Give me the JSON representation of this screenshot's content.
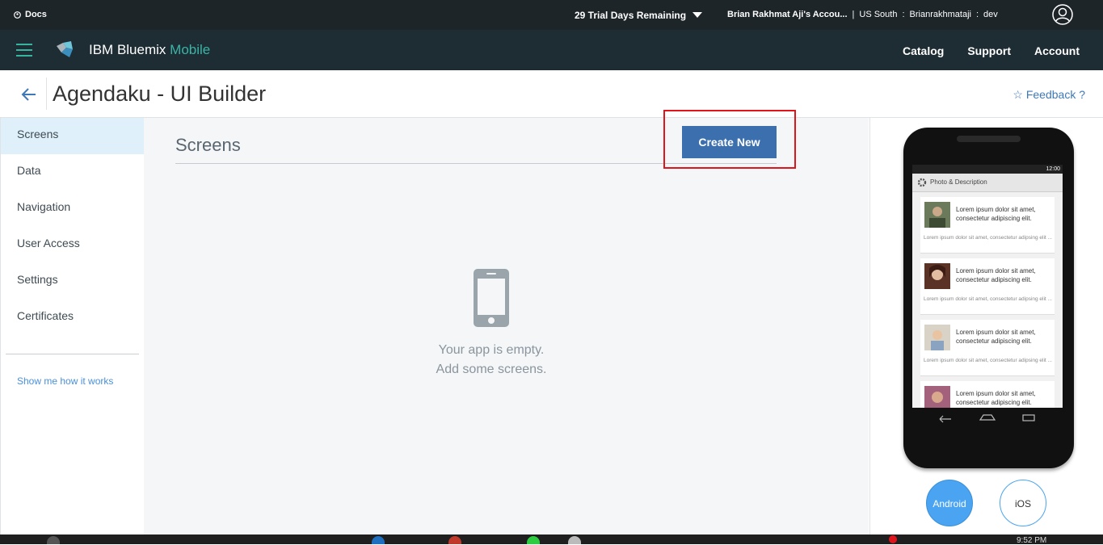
{
  "topbar": {
    "docs": "Docs",
    "trial": "29 Trial Days Remaining",
    "account_name": "Brian Rakhmat Aji's Accou...",
    "region": "US South",
    "colon1": ":",
    "org": "Brianrakhmataji",
    "colon2": ":",
    "space": "dev",
    "separator": "|"
  },
  "navbar": {
    "brand": "IBM Bluemix",
    "brand_suffix": "Mobile",
    "links": [
      "Catalog",
      "Support",
      "Account"
    ]
  },
  "header": {
    "title": "Agendaku - UI Builder",
    "feedback": "☆ Feedback ?"
  },
  "sidebar": {
    "items": [
      "Screens",
      "Data",
      "Navigation",
      "User Access",
      "Settings",
      "Certificates"
    ],
    "active": "Screens",
    "help_link": "Show me how it works"
  },
  "main": {
    "heading": "Screens",
    "create_button": "Create New",
    "empty_line1": "Your app is empty.",
    "empty_line2": "Add some screens."
  },
  "preview": {
    "status_time": "12:00",
    "app_title": "Photo & Description",
    "cards": [
      {
        "text": "Lorem ipsum dolor sit amet, consectetur adipiscing elit.",
        "sub": "Lorem ipsum dolor sit amet, consectetur adipsing elit ..."
      },
      {
        "text": "Lorem ipsum dolor sit amet, consectetur adipiscing elit.",
        "sub": "Lorem ipsum dolor sit amet, consectetur adipsing elit ..."
      },
      {
        "text": "Lorem ipsum dolor sit amet, consectetur adipiscing elit.",
        "sub": "Lorem ipsum dolor sit amet, consectetur adipsing elit ..."
      },
      {
        "text": "Lorem ipsum dolor sit amet, consectetur adipiscing elit.",
        "sub": ""
      }
    ],
    "toggle_android": "Android",
    "toggle_ios": "iOS"
  },
  "taskbar": {
    "clock": "9:52 PM"
  },
  "colors": {
    "topbar_bg": "#1d2529",
    "navbar_bg": "#1e2c34",
    "accent_teal": "#36b4a0",
    "button_blue": "#3b6fae",
    "highlight_red": "#e0151b",
    "android_blue": "#4aa4f1"
  }
}
